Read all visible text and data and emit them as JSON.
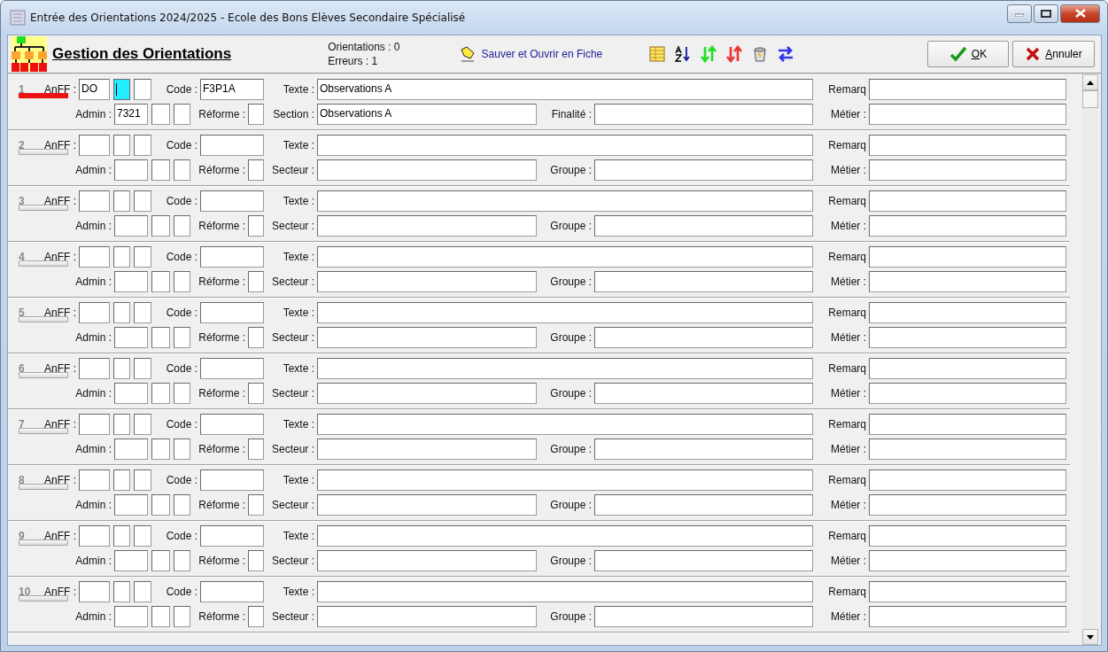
{
  "window": {
    "title": "Entrée des Orientations 2024/2025  -  Ecole des Bons Elèves Secondaire Spécialisé"
  },
  "toolbar": {
    "title": "Gestion des Orientations",
    "counts": [
      "Orientations : 0",
      "Erreurs : 1"
    ],
    "save_link": "Sauver et Ouvrir en Fiche",
    "buttons": [
      {
        "kind": "ok",
        "label": "OK"
      },
      {
        "kind": "cancel",
        "label": "Annuler"
      }
    ]
  },
  "rows": [
    {
      "number": "1",
      "error": true,
      "line1": [
        {
          "label": "AnFF :",
          "boxes": [
            {
              "value": "DO",
              "focused": false
            },
            {
              "focused": true
            },
            {
              "focused": false
            }
          ]
        },
        {
          "label": "Code :",
          "boxes": [
            {
              "value": "F3P1A",
              "focused": false
            }
          ]
        },
        {
          "label": "Texte :",
          "boxes": [
            {
              "value": "Observations A",
              "focused": false
            }
          ]
        },
        {
          "label": "Remarq",
          "boxes": [
            {
              "focused": false
            }
          ]
        }
      ],
      "line2": [
        {
          "label": "Admin :",
          "boxes": [
            {
              "value": "7321",
              "focused": false
            },
            {
              "focused": false
            },
            {
              "focused": false
            }
          ]
        },
        {
          "label": "Réforme :",
          "boxes": [
            {
              "focused": false
            }
          ]
        },
        {
          "label": "Section :",
          "boxes": [
            {
              "value": "Observations A",
              "focused": false
            }
          ]
        },
        {
          "label": "Finalité :",
          "boxes": [
            {
              "focused": false
            }
          ]
        },
        {
          "label": "Métier :",
          "boxes": [
            {
              "focused": false
            }
          ]
        }
      ]
    },
    {
      "number": "2",
      "error": false,
      "line1": [
        {
          "label": "AnFF :",
          "boxes": [
            {
              "focused": false
            },
            {
              "focused": false
            },
            {
              "focused": false
            }
          ]
        },
        {
          "label": "Code :",
          "boxes": [
            {
              "focused": false
            }
          ]
        },
        {
          "label": "Texte :",
          "boxes": [
            {
              "focused": false
            }
          ]
        },
        {
          "label": "Remarq",
          "boxes": [
            {
              "focused": false
            }
          ]
        }
      ],
      "line2": [
        {
          "label": "Admin :",
          "boxes": [
            {
              "focused": false
            },
            {
              "focused": false
            },
            {
              "focused": false
            }
          ]
        },
        {
          "label": "Réforme :",
          "boxes": [
            {
              "focused": false
            }
          ]
        },
        {
          "label": "Secteur :",
          "boxes": [
            {
              "focused": false
            }
          ]
        },
        {
          "label": "Groupe :",
          "boxes": [
            {
              "focused": false
            }
          ]
        },
        {
          "label": "Métier :",
          "boxes": [
            {
              "focused": false
            }
          ]
        }
      ]
    },
    {
      "number": "3",
      "error": false,
      "line1": [
        {
          "label": "AnFF :",
          "boxes": [
            {
              "focused": false
            },
            {
              "focused": false
            },
            {
              "focused": false
            }
          ]
        },
        {
          "label": "Code :",
          "boxes": [
            {
              "focused": false
            }
          ]
        },
        {
          "label": "Texte :",
          "boxes": [
            {
              "focused": false
            }
          ]
        },
        {
          "label": "Remarq",
          "boxes": [
            {
              "focused": false
            }
          ]
        }
      ],
      "line2": [
        {
          "label": "Admin :",
          "boxes": [
            {
              "focused": false
            },
            {
              "focused": false
            },
            {
              "focused": false
            }
          ]
        },
        {
          "label": "Réforme :",
          "boxes": [
            {
              "focused": false
            }
          ]
        },
        {
          "label": "Secteur :",
          "boxes": [
            {
              "focused": false
            }
          ]
        },
        {
          "label": "Groupe :",
          "boxes": [
            {
              "focused": false
            }
          ]
        },
        {
          "label": "Métier :",
          "boxes": [
            {
              "focused": false
            }
          ]
        }
      ]
    },
    {
      "number": "4",
      "error": false,
      "line1": [
        {
          "label": "AnFF :",
          "boxes": [
            {
              "focused": false
            },
            {
              "focused": false
            },
            {
              "focused": false
            }
          ]
        },
        {
          "label": "Code :",
          "boxes": [
            {
              "focused": false
            }
          ]
        },
        {
          "label": "Texte :",
          "boxes": [
            {
              "focused": false
            }
          ]
        },
        {
          "label": "Remarq",
          "boxes": [
            {
              "focused": false
            }
          ]
        }
      ],
      "line2": [
        {
          "label": "Admin :",
          "boxes": [
            {
              "focused": false
            },
            {
              "focused": false
            },
            {
              "focused": false
            }
          ]
        },
        {
          "label": "Réforme :",
          "boxes": [
            {
              "focused": false
            }
          ]
        },
        {
          "label": "Secteur :",
          "boxes": [
            {
              "focused": false
            }
          ]
        },
        {
          "label": "Groupe :",
          "boxes": [
            {
              "focused": false
            }
          ]
        },
        {
          "label": "Métier :",
          "boxes": [
            {
              "focused": false
            }
          ]
        }
      ]
    },
    {
      "number": "5",
      "error": false,
      "line1": [
        {
          "label": "AnFF :",
          "boxes": [
            {
              "focused": false
            },
            {
              "focused": false
            },
            {
              "focused": false
            }
          ]
        },
        {
          "label": "Code :",
          "boxes": [
            {
              "focused": false
            }
          ]
        },
        {
          "label": "Texte :",
          "boxes": [
            {
              "focused": false
            }
          ]
        },
        {
          "label": "Remarq",
          "boxes": [
            {
              "focused": false
            }
          ]
        }
      ],
      "line2": [
        {
          "label": "Admin :",
          "boxes": [
            {
              "focused": false
            },
            {
              "focused": false
            },
            {
              "focused": false
            }
          ]
        },
        {
          "label": "Réforme :",
          "boxes": [
            {
              "focused": false
            }
          ]
        },
        {
          "label": "Secteur :",
          "boxes": [
            {
              "focused": false
            }
          ]
        },
        {
          "label": "Groupe :",
          "boxes": [
            {
              "focused": false
            }
          ]
        },
        {
          "label": "Métier :",
          "boxes": [
            {
              "focused": false
            }
          ]
        }
      ]
    },
    {
      "number": "6",
      "error": false,
      "line1": [
        {
          "label": "AnFF :",
          "boxes": [
            {
              "focused": false
            },
            {
              "focused": false
            },
            {
              "focused": false
            }
          ]
        },
        {
          "label": "Code :",
          "boxes": [
            {
              "focused": false
            }
          ]
        },
        {
          "label": "Texte :",
          "boxes": [
            {
              "focused": false
            }
          ]
        },
        {
          "label": "Remarq",
          "boxes": [
            {
              "focused": false
            }
          ]
        }
      ],
      "line2": [
        {
          "label": "Admin :",
          "boxes": [
            {
              "focused": false
            },
            {
              "focused": false
            },
            {
              "focused": false
            }
          ]
        },
        {
          "label": "Réforme :",
          "boxes": [
            {
              "focused": false
            }
          ]
        },
        {
          "label": "Secteur :",
          "boxes": [
            {
              "focused": false
            }
          ]
        },
        {
          "label": "Groupe :",
          "boxes": [
            {
              "focused": false
            }
          ]
        },
        {
          "label": "Métier :",
          "boxes": [
            {
              "focused": false
            }
          ]
        }
      ]
    },
    {
      "number": "7",
      "error": false,
      "line1": [
        {
          "label": "AnFF :",
          "boxes": [
            {
              "focused": false
            },
            {
              "focused": false
            },
            {
              "focused": false
            }
          ]
        },
        {
          "label": "Code :",
          "boxes": [
            {
              "focused": false
            }
          ]
        },
        {
          "label": "Texte :",
          "boxes": [
            {
              "focused": false
            }
          ]
        },
        {
          "label": "Remarq",
          "boxes": [
            {
              "focused": false
            }
          ]
        }
      ],
      "line2": [
        {
          "label": "Admin :",
          "boxes": [
            {
              "focused": false
            },
            {
              "focused": false
            },
            {
              "focused": false
            }
          ]
        },
        {
          "label": "Réforme :",
          "boxes": [
            {
              "focused": false
            }
          ]
        },
        {
          "label": "Secteur :",
          "boxes": [
            {
              "focused": false
            }
          ]
        },
        {
          "label": "Groupe :",
          "boxes": [
            {
              "focused": false
            }
          ]
        },
        {
          "label": "Métier :",
          "boxes": [
            {
              "focused": false
            }
          ]
        }
      ]
    },
    {
      "number": "8",
      "error": false,
      "line1": [
        {
          "label": "AnFF :",
          "boxes": [
            {
              "focused": false
            },
            {
              "focused": false
            },
            {
              "focused": false
            }
          ]
        },
        {
          "label": "Code :",
          "boxes": [
            {
              "focused": false
            }
          ]
        },
        {
          "label": "Texte :",
          "boxes": [
            {
              "focused": false
            }
          ]
        },
        {
          "label": "Remarq",
          "boxes": [
            {
              "focused": false
            }
          ]
        }
      ],
      "line2": [
        {
          "label": "Admin :",
          "boxes": [
            {
              "focused": false
            },
            {
              "focused": false
            },
            {
              "focused": false
            }
          ]
        },
        {
          "label": "Réforme :",
          "boxes": [
            {
              "focused": false
            }
          ]
        },
        {
          "label": "Secteur :",
          "boxes": [
            {
              "focused": false
            }
          ]
        },
        {
          "label": "Groupe :",
          "boxes": [
            {
              "focused": false
            }
          ]
        },
        {
          "label": "Métier :",
          "boxes": [
            {
              "focused": false
            }
          ]
        }
      ]
    },
    {
      "number": "9",
      "error": false,
      "line1": [
        {
          "label": "AnFF :",
          "boxes": [
            {
              "focused": false
            },
            {
              "focused": false
            },
            {
              "focused": false
            }
          ]
        },
        {
          "label": "Code :",
          "boxes": [
            {
              "focused": false
            }
          ]
        },
        {
          "label": "Texte :",
          "boxes": [
            {
              "focused": false
            }
          ]
        },
        {
          "label": "Remarq",
          "boxes": [
            {
              "focused": false
            }
          ]
        }
      ],
      "line2": [
        {
          "label": "Admin :",
          "boxes": [
            {
              "focused": false
            },
            {
              "focused": false
            },
            {
              "focused": false
            }
          ]
        },
        {
          "label": "Réforme :",
          "boxes": [
            {
              "focused": false
            }
          ]
        },
        {
          "label": "Secteur :",
          "boxes": [
            {
              "focused": false
            }
          ]
        },
        {
          "label": "Groupe :",
          "boxes": [
            {
              "focused": false
            }
          ]
        },
        {
          "label": "Métier :",
          "boxes": [
            {
              "focused": false
            }
          ]
        }
      ]
    },
    {
      "number": "10",
      "error": false,
      "line1": [
        {
          "label": "AnFF :",
          "boxes": [
            {
              "focused": false
            },
            {
              "focused": false
            },
            {
              "focused": false
            }
          ]
        },
        {
          "label": "Code :",
          "boxes": [
            {
              "focused": false
            }
          ]
        },
        {
          "label": "Texte :",
          "boxes": [
            {
              "focused": false
            }
          ]
        },
        {
          "label": "Remarq",
          "boxes": [
            {
              "focused": false
            }
          ]
        }
      ],
      "line2": [
        {
          "label": "Admin :",
          "boxes": [
            {
              "focused": false
            },
            {
              "focused": false
            },
            {
              "focused": false
            }
          ]
        },
        {
          "label": "Réforme :",
          "boxes": [
            {
              "focused": false
            }
          ]
        },
        {
          "label": "Secteur :",
          "boxes": [
            {
              "focused": false
            }
          ]
        },
        {
          "label": "Groupe :",
          "boxes": [
            {
              "focused": false
            }
          ]
        },
        {
          "label": "Métier :",
          "boxes": [
            {
              "focused": false
            }
          ]
        }
      ]
    }
  ]
}
